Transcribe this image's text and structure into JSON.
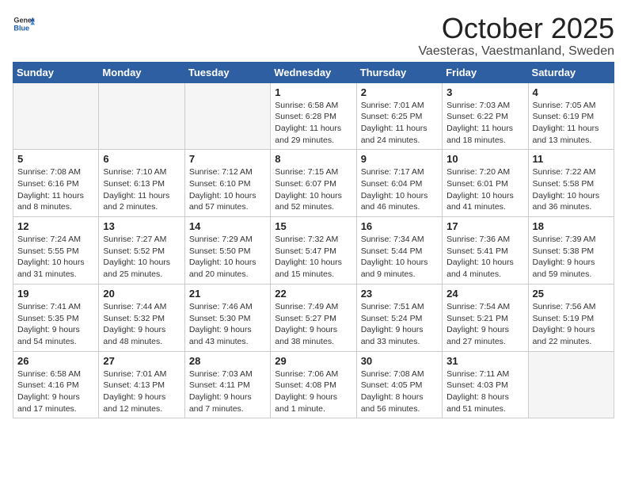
{
  "header": {
    "logo_general": "General",
    "logo_blue": "Blue",
    "month_title": "October 2025",
    "location": "Vaesteras, Vaestmanland, Sweden"
  },
  "weekdays": [
    "Sunday",
    "Monday",
    "Tuesday",
    "Wednesday",
    "Thursday",
    "Friday",
    "Saturday"
  ],
  "weeks": [
    [
      {
        "day": "",
        "info": ""
      },
      {
        "day": "",
        "info": ""
      },
      {
        "day": "",
        "info": ""
      },
      {
        "day": "1",
        "info": "Sunrise: 6:58 AM\nSunset: 6:28 PM\nDaylight: 11 hours\nand 29 minutes."
      },
      {
        "day": "2",
        "info": "Sunrise: 7:01 AM\nSunset: 6:25 PM\nDaylight: 11 hours\nand 24 minutes."
      },
      {
        "day": "3",
        "info": "Sunrise: 7:03 AM\nSunset: 6:22 PM\nDaylight: 11 hours\nand 18 minutes."
      },
      {
        "day": "4",
        "info": "Sunrise: 7:05 AM\nSunset: 6:19 PM\nDaylight: 11 hours\nand 13 minutes."
      }
    ],
    [
      {
        "day": "5",
        "info": "Sunrise: 7:08 AM\nSunset: 6:16 PM\nDaylight: 11 hours\nand 8 minutes."
      },
      {
        "day": "6",
        "info": "Sunrise: 7:10 AM\nSunset: 6:13 PM\nDaylight: 11 hours\nand 2 minutes."
      },
      {
        "day": "7",
        "info": "Sunrise: 7:12 AM\nSunset: 6:10 PM\nDaylight: 10 hours\nand 57 minutes."
      },
      {
        "day": "8",
        "info": "Sunrise: 7:15 AM\nSunset: 6:07 PM\nDaylight: 10 hours\nand 52 minutes."
      },
      {
        "day": "9",
        "info": "Sunrise: 7:17 AM\nSunset: 6:04 PM\nDaylight: 10 hours\nand 46 minutes."
      },
      {
        "day": "10",
        "info": "Sunrise: 7:20 AM\nSunset: 6:01 PM\nDaylight: 10 hours\nand 41 minutes."
      },
      {
        "day": "11",
        "info": "Sunrise: 7:22 AM\nSunset: 5:58 PM\nDaylight: 10 hours\nand 36 minutes."
      }
    ],
    [
      {
        "day": "12",
        "info": "Sunrise: 7:24 AM\nSunset: 5:55 PM\nDaylight: 10 hours\nand 31 minutes."
      },
      {
        "day": "13",
        "info": "Sunrise: 7:27 AM\nSunset: 5:52 PM\nDaylight: 10 hours\nand 25 minutes."
      },
      {
        "day": "14",
        "info": "Sunrise: 7:29 AM\nSunset: 5:50 PM\nDaylight: 10 hours\nand 20 minutes."
      },
      {
        "day": "15",
        "info": "Sunrise: 7:32 AM\nSunset: 5:47 PM\nDaylight: 10 hours\nand 15 minutes."
      },
      {
        "day": "16",
        "info": "Sunrise: 7:34 AM\nSunset: 5:44 PM\nDaylight: 10 hours\nand 9 minutes."
      },
      {
        "day": "17",
        "info": "Sunrise: 7:36 AM\nSunset: 5:41 PM\nDaylight: 10 hours\nand 4 minutes."
      },
      {
        "day": "18",
        "info": "Sunrise: 7:39 AM\nSunset: 5:38 PM\nDaylight: 9 hours\nand 59 minutes."
      }
    ],
    [
      {
        "day": "19",
        "info": "Sunrise: 7:41 AM\nSunset: 5:35 PM\nDaylight: 9 hours\nand 54 minutes."
      },
      {
        "day": "20",
        "info": "Sunrise: 7:44 AM\nSunset: 5:32 PM\nDaylight: 9 hours\nand 48 minutes."
      },
      {
        "day": "21",
        "info": "Sunrise: 7:46 AM\nSunset: 5:30 PM\nDaylight: 9 hours\nand 43 minutes."
      },
      {
        "day": "22",
        "info": "Sunrise: 7:49 AM\nSunset: 5:27 PM\nDaylight: 9 hours\nand 38 minutes."
      },
      {
        "day": "23",
        "info": "Sunrise: 7:51 AM\nSunset: 5:24 PM\nDaylight: 9 hours\nand 33 minutes."
      },
      {
        "day": "24",
        "info": "Sunrise: 7:54 AM\nSunset: 5:21 PM\nDaylight: 9 hours\nand 27 minutes."
      },
      {
        "day": "25",
        "info": "Sunrise: 7:56 AM\nSunset: 5:19 PM\nDaylight: 9 hours\nand 22 minutes."
      }
    ],
    [
      {
        "day": "26",
        "info": "Sunrise: 6:58 AM\nSunset: 4:16 PM\nDaylight: 9 hours\nand 17 minutes."
      },
      {
        "day": "27",
        "info": "Sunrise: 7:01 AM\nSunset: 4:13 PM\nDaylight: 9 hours\nand 12 minutes."
      },
      {
        "day": "28",
        "info": "Sunrise: 7:03 AM\nSunset: 4:11 PM\nDaylight: 9 hours\nand 7 minutes."
      },
      {
        "day": "29",
        "info": "Sunrise: 7:06 AM\nSunset: 4:08 PM\nDaylight: 9 hours\nand 1 minute."
      },
      {
        "day": "30",
        "info": "Sunrise: 7:08 AM\nSunset: 4:05 PM\nDaylight: 8 hours\nand 56 minutes."
      },
      {
        "day": "31",
        "info": "Sunrise: 7:11 AM\nSunset: 4:03 PM\nDaylight: 8 hours\nand 51 minutes."
      },
      {
        "day": "",
        "info": ""
      }
    ]
  ]
}
